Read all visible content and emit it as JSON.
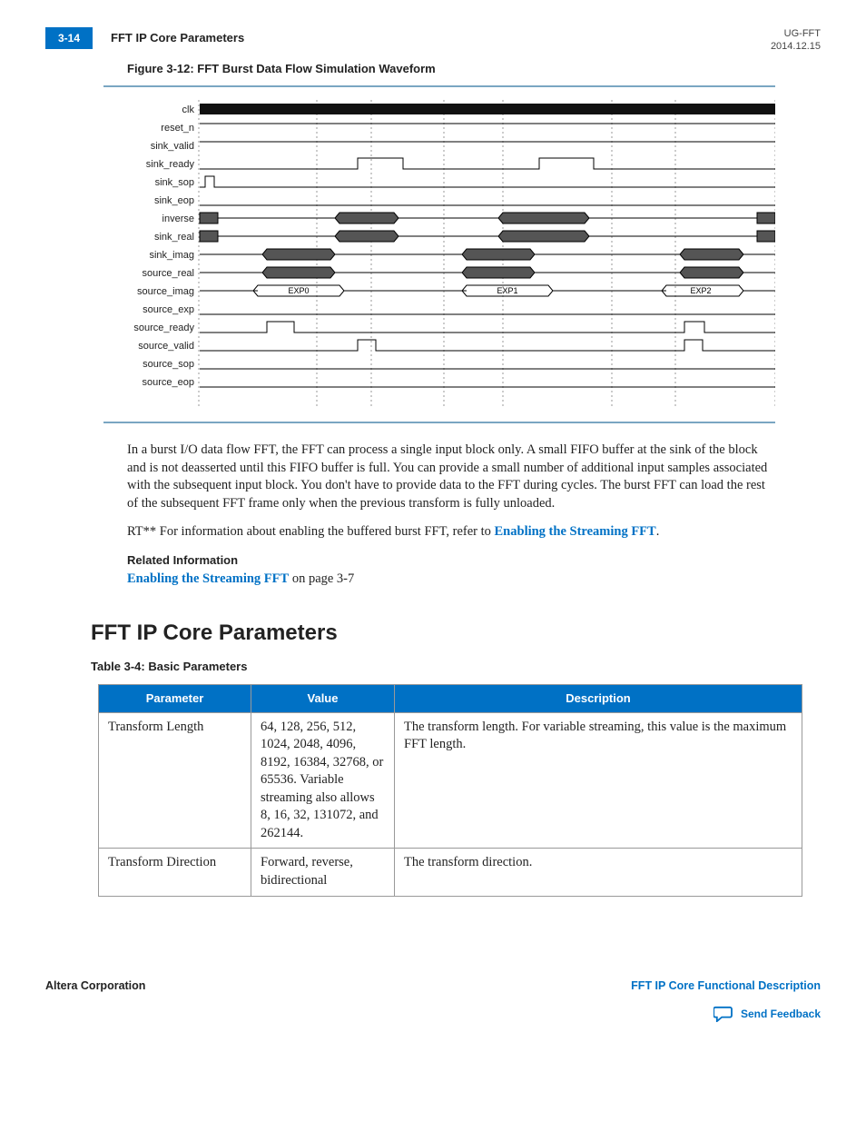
{
  "header": {
    "page_num": "3-14",
    "running_title": "FFT IP Core Parameters",
    "doc_code": "UG-FFT",
    "doc_date": "2014.12.15"
  },
  "figure": {
    "title": "Figure 3-12: FFT Burst Data Flow Simulation Waveform",
    "signals": [
      "clk",
      "reset_n",
      "sink_valid",
      "sink_ready",
      "sink_sop",
      "sink_eop",
      "inverse",
      "sink_real",
      "sink_imag",
      "source_real",
      "source_imag",
      "source_exp",
      "source_ready",
      "source_valid",
      "source_sop",
      "source_eop"
    ],
    "exp_labels": [
      "EXP0",
      "EXP1",
      "EXP2"
    ]
  },
  "paragraphs": {
    "p1": "In a burst I/O data flow FFT, the FFT can process a single input block only. A small FIFO buffer at the sink of the block and                            is not deasserted until this FIFO buffer is full. You can provide a small number of additional input samples associated with the subsequent input block. You don't have to provide data to the FFT during                            cycles. The burst FFT can load the rest of the subsequent FFT frame only when the previous transform is fully unloaded.",
    "p2_prefix": "RT** For information about enabling the buffered burst FFT, refer to ",
    "p2_link": "Enabling the Streaming FFT",
    "p2_suffix": ".",
    "related_title": "Related Information",
    "related_link": "Enabling the Streaming FFT",
    "related_suffix": " on page 3-7"
  },
  "section_heading": "FFT IP Core Parameters",
  "table": {
    "caption": "Table 3-4: Basic Parameters",
    "headers": [
      "Parameter",
      "Value",
      "Description"
    ],
    "rows": [
      {
        "param": "Transform Length",
        "value": "64, 128, 256, 512, 1024, 2048, 4096, 8192, 16384, 32768, or 65536. Variable streaming also allows 8, 16, 32, 131072, and 262144.",
        "desc": "The transform length. For variable streaming, this value is the maximum FFT length."
      },
      {
        "param": "Transform Direction",
        "value": "Forward, reverse, bidirectional",
        "desc": "The transform direction."
      }
    ]
  },
  "footer": {
    "left": "Altera Corporation",
    "right_link": "FFT IP Core Functional Description",
    "feedback": "Send Feedback"
  }
}
